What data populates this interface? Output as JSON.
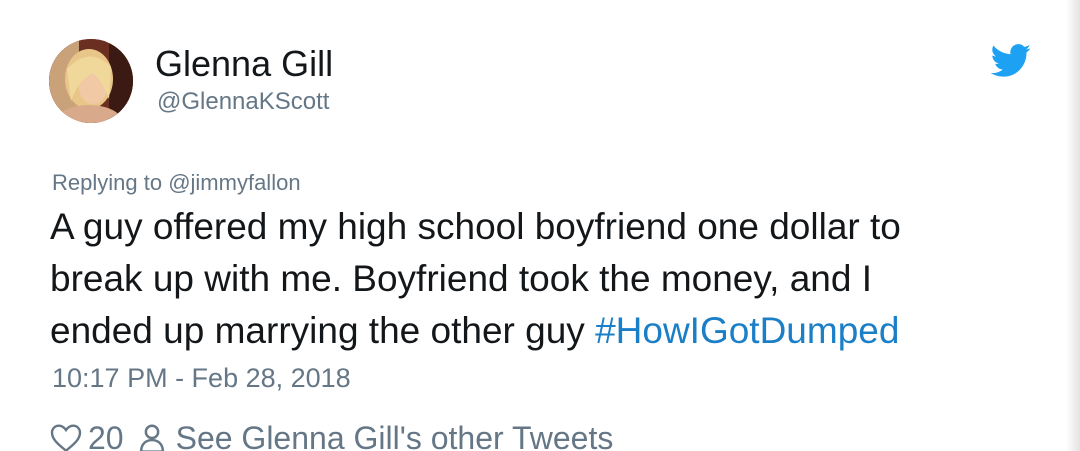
{
  "tweet": {
    "author_name": "Glenna Gill",
    "author_handle": "@GlennaKScott",
    "replying_prefix": "Replying to",
    "replying_to": "@jimmyfallon",
    "text_lines": [
      "A guy offered my high school boyfriend one dollar to",
      "break up with me. Boyfriend took the money, and I",
      "ended up marrying the other guy"
    ],
    "hashtag": "#HowIGotDumped",
    "timestamp": "10:17 PM - Feb 28, 2018",
    "like_count": "20",
    "other_tweets_label": "See Glenna Gill's other Tweets"
  },
  "icons": {
    "brand": "twitter-bird-icon",
    "like": "heart-icon",
    "profile": "person-icon"
  },
  "colors": {
    "brand_blue": "#1da1f2",
    "hashtag": "#1b7fc7",
    "secondary_text": "#657786",
    "primary_text": "#14171a"
  }
}
